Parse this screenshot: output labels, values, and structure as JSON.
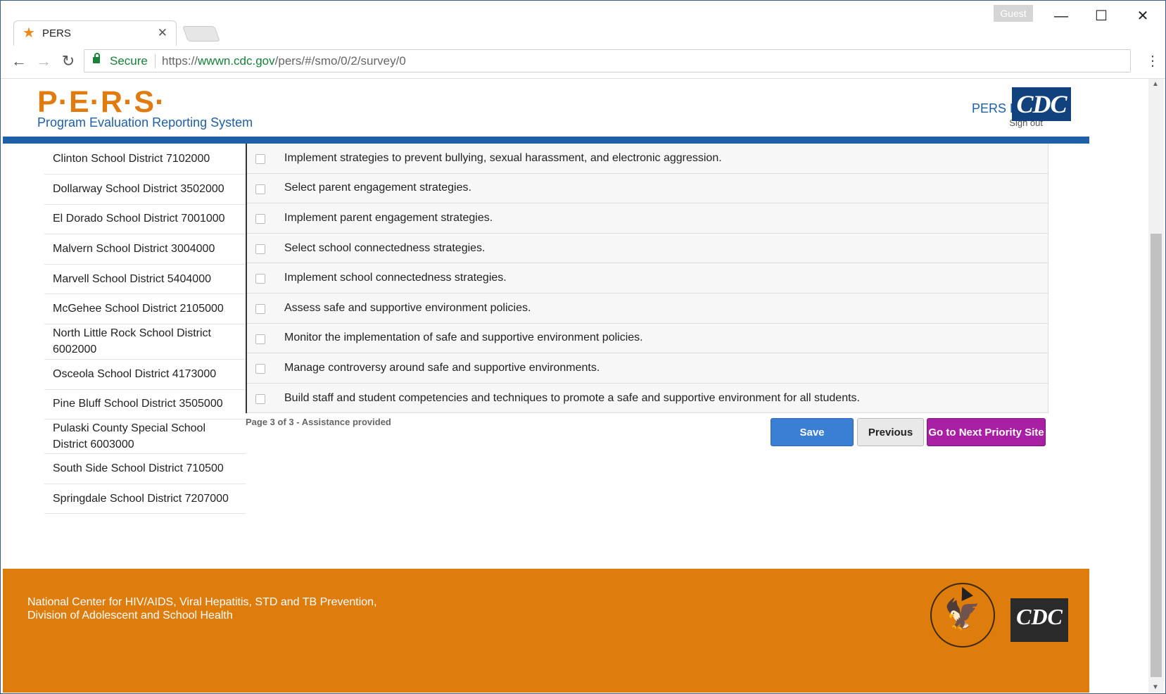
{
  "browser": {
    "tab_title": "PERS",
    "profile": "Guest",
    "secure_label": "Secure",
    "url_scheme": "https://",
    "url_host": "wwwn.cdc.gov",
    "url_path": "/pers/#/smo/0/2/survey/0"
  },
  "header": {
    "logo_text": "P·E·R·S·",
    "logo_subtitle": "Program Evaluation Reporting System",
    "user_role": "PERS Editor",
    "sign_out": "Sign out",
    "cdc_logo": "CDC"
  },
  "sidebar": {
    "items": [
      "Clinton School District 7102000",
      "Dollarway School District 3502000",
      "El Dorado School District 7001000",
      "Malvern School District 3004000",
      "Marvell School District 5404000",
      "McGehee School District 2105000",
      "North Little Rock School District 6002000",
      "Osceola School District 4173000",
      "Pine Bluff School District 3505000",
      "Pulaski County Special School District 6003000",
      "South Side School District 710500",
      "Springdale School District 7207000"
    ]
  },
  "survey": {
    "items": [
      {
        "label": "Implement strategies to prevent bullying, sexual harassment, and electronic aggression.",
        "checked": false
      },
      {
        "label": "Select parent engagement strategies.",
        "checked": false
      },
      {
        "label": "Implement parent engagement strategies.",
        "checked": false
      },
      {
        "label": "Select school connectedness strategies.",
        "checked": false
      },
      {
        "label": "Implement school connectedness strategies.",
        "checked": false
      },
      {
        "label": "Assess safe and supportive environment policies.",
        "checked": false
      },
      {
        "label": "Monitor the implementation of safe and supportive environment policies.",
        "checked": false
      },
      {
        "label": "Manage controversy around safe and supportive environments.",
        "checked": false
      },
      {
        "label": "Build staff and student competencies and techniques to promote a safe and supportive environment for all students.",
        "checked": false
      }
    ],
    "page_info": "Page 3 of 3 - Assistance provided",
    "save_label": "Save",
    "previous_label": "Previous",
    "next_label": "Go to Next Priority Site"
  },
  "footer": {
    "line1": "National Center for HIV/AIDS, Viral Hepatitis, STD and TB Prevention,",
    "line2": "Division of Adolescent and School Health",
    "cdc_logo": "CDC"
  },
  "colors": {
    "brand_orange": "#df7d0c",
    "brand_blue": "#1f5fa6",
    "save_blue": "#3b7fd4",
    "next_purple": "#a81fa4"
  }
}
